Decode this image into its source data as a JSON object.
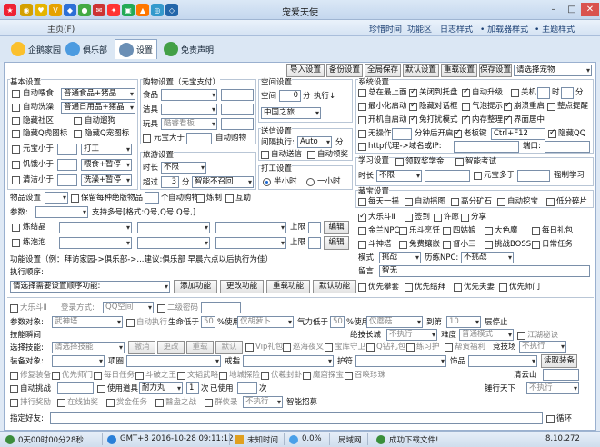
{
  "window": {
    "title": "宠爱天使"
  },
  "menu": {
    "home": "主页(F)",
    "items": [
      "珍惜时间",
      "功能区",
      "日志样式",
      "• 加载器样式",
      "• 主题样式"
    ]
  },
  "tabs": [
    "企鹅家园",
    "俱乐部",
    "设置",
    "免责声明"
  ],
  "toolbar": [
    "导入设置",
    "备份设置",
    "全局保存",
    "默认设置",
    "重载设置",
    "保存设置"
  ],
  "pet_select": "请选择宠物",
  "basic": {
    "title": "基本设置",
    "feed": "自动喂食",
    "feed_dd": "普通食品+猪晶",
    "clean": "自动洗澡",
    "clean_dd": "普通日用品+猪晶",
    "hide_community": "隐藏社区",
    "auto_walk": "自动遛狗",
    "hide_tiger": "隐藏Q虎图标",
    "hide_pet": "隐藏Q宠图标",
    "yuanbao": "元宝小于",
    "yuanbao_dd": "打工",
    "hunger": "饥饿小于",
    "hunger_dd": "喂食+暂停",
    "clean_lt": "清洁小于",
    "clean_lt_dd": "洗澡+暂停"
  },
  "shop": {
    "title": "购物设置（元宝支付）",
    "food": "食品",
    "supplies": "洁具",
    "toy": "玩具",
    "toy_dd": "酷睿看板",
    "yuanbao_gt": "元宝大于",
    "auto_buy": "自动购物"
  },
  "travel": {
    "title": "旅游设置",
    "duration": "时长",
    "duration_dd": "不限",
    "exceed": "超过",
    "exceed_val": "3",
    "minutes": "分",
    "exceed_dd": "智能不召回"
  },
  "space": {
    "title": "空间设置",
    "space": "空间",
    "space_val": "0",
    "minutes": "分",
    "exec": "执行↓",
    "space_dd": "中国之旅"
  },
  "delivery": {
    "title": "送信设置",
    "interval": "间隔执行:",
    "auto": "Auto",
    "min": "分",
    "auto_send": "自动送信",
    "auto_receive": "自动领奖"
  },
  "work": {
    "title": "打工设置",
    "half": "半小时",
    "one": "一小时"
  },
  "system": {
    "title": "系统设置",
    "top": "总在最上面",
    "close_tray": "关闭到托盘",
    "auto_upgrade": "自动升级",
    "shutdown": "关机",
    "hour": "时",
    "minute": "分",
    "min_start": "最小化启动",
    "hide_dialog": "隐藏对话框",
    "fever": "气泡提示",
    "crash_restart": "崩溃重启",
    "task_remind": "整点提醒",
    "boot": "开机自启动",
    "free_ad": "免打扰模式",
    "mem_clean": "内存整理",
    "ui_center": "界面居中",
    "no_op": "无操作",
    "window": "分钟后开启",
    "boss_key": "老板键",
    "boss_key_val": "Ctrl+F12",
    "hide_qq": "隐藏QQ",
    "proxy": "http代理->域名或IP:",
    "port": "端口:"
  },
  "study": {
    "title": "学习设置",
    "receive": "领取奖学金",
    "smart": "智能考试",
    "duration": "时长",
    "dd": "不限",
    "yuanbao": "元宝多于",
    "force": "强制学习"
  },
  "treasure": {
    "title": "藏宝设置",
    "items": [
      "每天一摇",
      "自动摇图",
      "高分矿石",
      "自动挖宝",
      "低分碎片"
    ]
  },
  "tasks": {
    "items": [
      "大乐斗Ⅱ",
      "签到",
      "许愿",
      "分享",
      "金兰NPC",
      "乐斗烹饪",
      "四姑娘",
      "大色魔",
      "每日礼包",
      "斗神塔",
      "免费镶嵌",
      "督小三",
      "挑战BOSS",
      "日常任务"
    ],
    "mode_label": "模式:",
    "mode_dd": "挑战",
    "history": "历练NPC:",
    "history_dd": "不挑战",
    "msg_label": "留言:",
    "msg_val": "智无",
    "options": [
      "优先攀套",
      "优先结拜",
      "优先夫妻",
      "优先师门"
    ]
  },
  "items": {
    "label": "物品设置",
    "keep_new": "保留每种绝版物品",
    "n": "个",
    "auto_buy": "自动购物",
    "make": "炼制",
    "help": "互助",
    "param": "参数:",
    "support": "支持多号[格式:Q号,Q号,Q号,]",
    "lianjing": "炼结晶",
    "lianpao": "练泡泡",
    "upper": "上限",
    "edit": "编辑"
  },
  "func": {
    "title": "功能设置（例：拜访家园->俱乐部->...建议:俱乐部 早晨六点以后执行为佳）",
    "order": "执行顺序:",
    "order_dd": "请选择需要设置顺序功能:",
    "add": "添加功能",
    "modify": "更改功能",
    "reload": "重载功能",
    "default": "默认功能"
  },
  "ledou": {
    "title": "大乐斗Ⅱ",
    "login": "登录方式:",
    "login_dd": "QQ空间",
    "pwd": "二级密码"
  },
  "battle": {
    "target": "参数对象:",
    "target_dd": "武神塔",
    "auto": "自动执行",
    "life": "生命低于",
    "life_val": "50",
    "pct": "%使用",
    "life_dd": "仅胡萝卜",
    "qi": "气力低于",
    "qi_val": "50",
    "qi_dd": "仅蘑菇",
    "to": "到第",
    "to_val": "10",
    "floor": "层停止",
    "skill_set": "技能瞬间",
    "skill_label": "技能瞬间:",
    "uniq": "绝技长城",
    "uniq_dd": "不执行",
    "diff": "难度",
    "diff_dd": "普通模式",
    "river": "江湖秘诀",
    "select": "选择技能:",
    "select_dd": "请选择技能",
    "cancel": "撤消",
    "change": "更改",
    "reload": "重载",
    "default": "默认",
    "vip": "Vip礼包",
    "mountain": "巡海夜叉",
    "treasure": "宝库守卫",
    "qzone": "Q钻礼包",
    "practice": "练习护",
    "guild": "帮贡福利",
    "arena": "竞技场",
    "arena_dd": "不执行",
    "equip": "装备对象:",
    "item": "项圈",
    "ring": "戒指",
    "guard": "护符",
    "goods": "饰品",
    "get_equip": "读取装备",
    "fix": "修复装备",
    "master": "优先师门",
    "daily": "每日任务",
    "fight_king": "斗破之王",
    "wenwu": "文韬武略",
    "landmine": "地城探险",
    "chars": "伏羲封卦",
    "magic": "魔窟探宝",
    "call": "召唤珍珠",
    "clear_cloud": "清云山",
    "auto_fight": "自动挑战",
    "use_mana": "使用道具",
    "endure": "耐力丸",
    "one": "1",
    "times": "次",
    "stop": "已使用",
    "lianba": "次",
    "tianxia": "锤行天下",
    "tianxia_dd": "不执行",
    "rank": "排行奖励",
    "online": "在线抽奖",
    "gold": "赏金任务",
    "xuezhan": "醫盘之战",
    "group": "群侠录",
    "group_dd": "不执行",
    "smart": "智能招募",
    "friend": "指定好友:",
    "loop": "循环"
  },
  "status": {
    "uptime": "0天00时00分28秒",
    "tz": "GMT+8 2016-10-28 09:11:12",
    "login": "未知时间",
    "pct": "0.0%",
    "net": "局域网",
    "done": "成功下载文件!",
    "version": "8.10.272"
  }
}
